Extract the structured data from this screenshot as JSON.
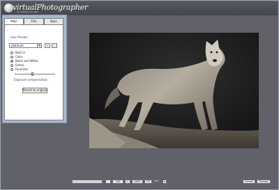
{
  "header": {
    "app_name": "virtualPhotographer",
    "app_subtitle": "by Optikvervve Labs"
  },
  "panel": {
    "tabs": [
      {
        "label": "Main",
        "active": true
      },
      {
        "label": "Film",
        "active": false
      },
      {
        "label": "Style",
        "active": false
      }
    ],
    "presets_heading": "User Presets",
    "preset_value": "platinum",
    "preset_buttons": [
      "+",
      "-"
    ],
    "radio_options": [
      {
        "label": "Built in",
        "selected": false
      },
      {
        "label": "Color",
        "selected": false
      },
      {
        "label": "Black and White",
        "selected": true
      },
      {
        "label": "Extras",
        "selected": false
      },
      {
        "label": "Favorites",
        "selected": false
      }
    ],
    "exposure_label": "Exposure compensation",
    "exposure_level": 0.45,
    "revert_label": "Revert to original"
  },
  "preview": {
    "image_icon": "wolf-photo"
  },
  "bottom": {
    "zoom_minus": "-",
    "zoom_value": "100",
    "zoom_plus": "+",
    "field_value": "0003",
    "fit_label": "FIT",
    "half_label": "half",
    "cancel_label": "Cancel",
    "process_label": "Process"
  },
  "colors": {
    "background": "#606169",
    "panel": "#aab8ce",
    "accent_text": "#1c3f8c"
  }
}
